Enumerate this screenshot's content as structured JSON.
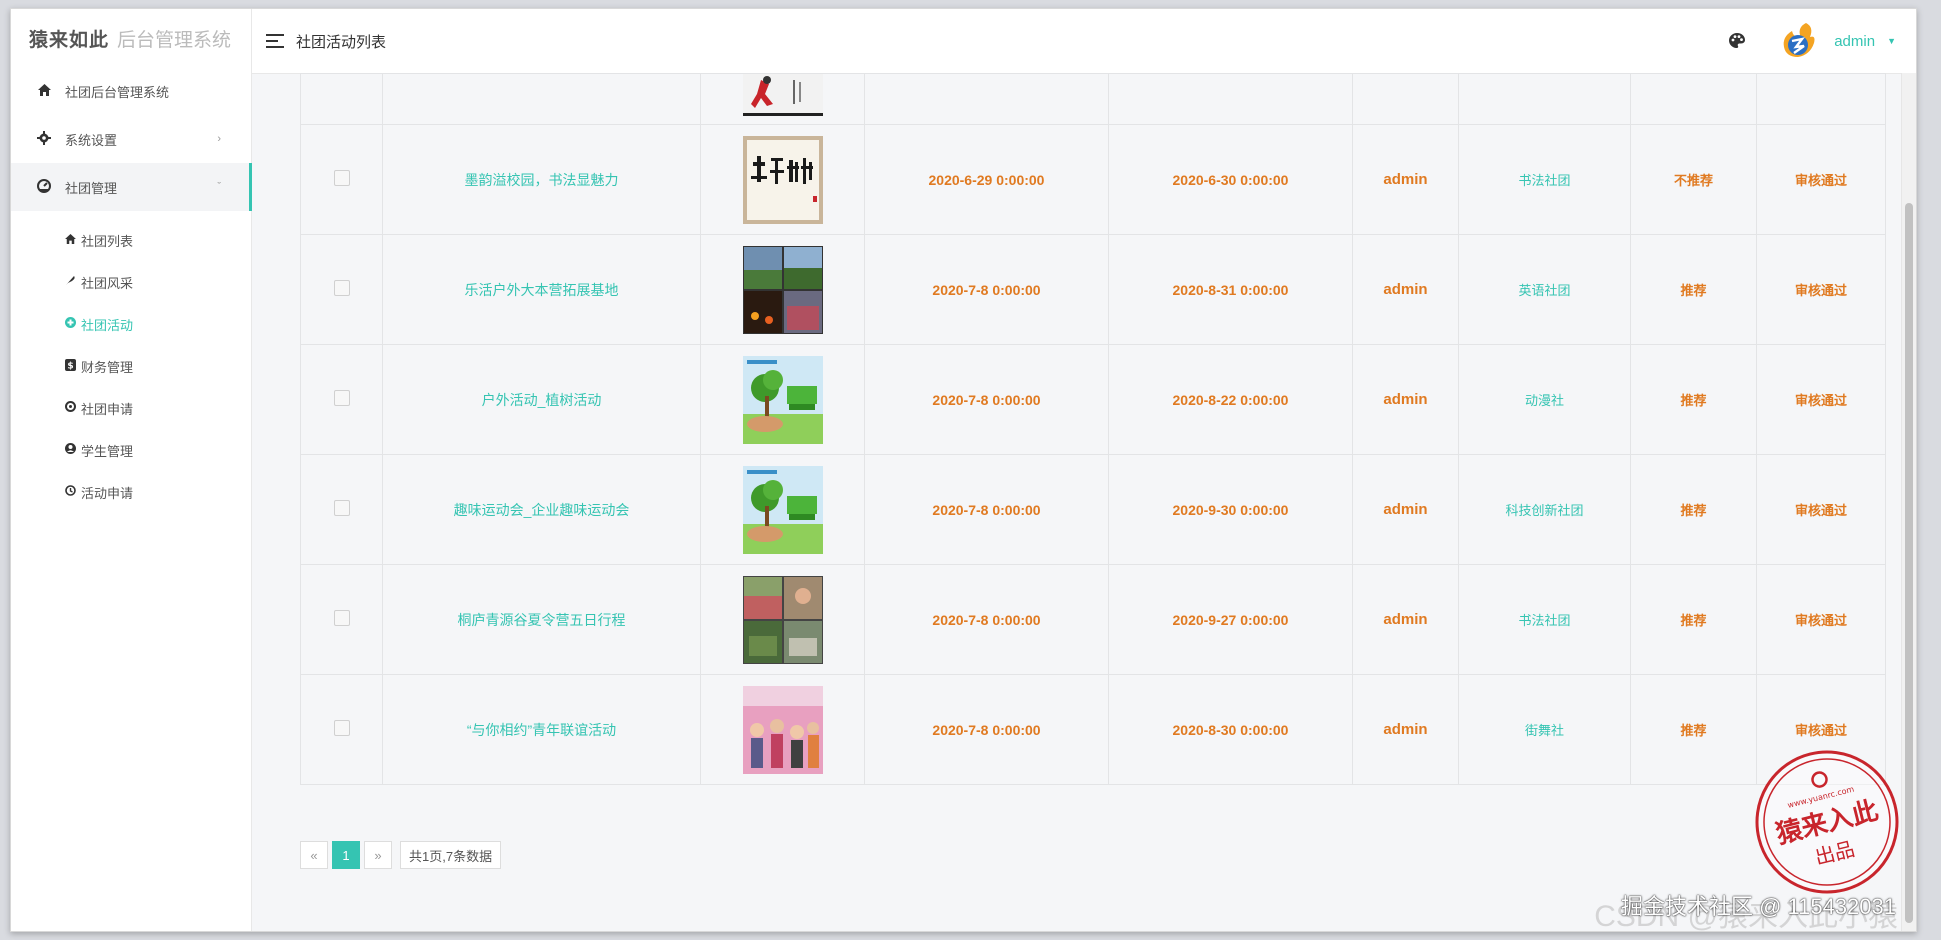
{
  "brand": {
    "logo_text": "猿来如此",
    "system_name": "后台管理系统"
  },
  "sidebar": {
    "items": [
      {
        "label": "社团后台管理系统",
        "icon": "home-icon"
      },
      {
        "label": "系统设置",
        "icon": "gear-icon",
        "arrow": "›"
      },
      {
        "label": "社团管理",
        "icon": "dashboard-icon",
        "arrow": "ˇ"
      }
    ],
    "submenu": [
      {
        "label": "社团列表",
        "icon": "home-icon"
      },
      {
        "label": "社团风采",
        "icon": "feather-icon"
      },
      {
        "label": "社团活动",
        "icon": "circle-plus-icon"
      },
      {
        "label": "财务管理",
        "icon": "dollar-icon"
      },
      {
        "label": "社团申请",
        "icon": "ring-icon"
      },
      {
        "label": "学生管理",
        "icon": "user-circle-icon"
      },
      {
        "label": "活动申请",
        "icon": "history-icon"
      }
    ]
  },
  "header": {
    "title": "社团活动列表",
    "user": "admin"
  },
  "table": {
    "rows": [
      {
        "title": "墨韵溢校园，书法显魅力",
        "image": "calligraphy",
        "start": "2020-6-29 0:00:00",
        "end": "2020-6-30 0:00:00",
        "author": "admin",
        "club": "书法社团",
        "recommend": "不推荐",
        "status": "审核通过"
      },
      {
        "title": "乐活户外大本营拓展基地",
        "image": "group-photos",
        "start": "2020-7-8 0:00:00",
        "end": "2020-8-31 0:00:00",
        "author": "admin",
        "club": "英语社团",
        "recommend": "推荐",
        "status": "审核通过"
      },
      {
        "title": "户外活动_植树活动",
        "image": "tree-planting",
        "start": "2020-7-8 0:00:00",
        "end": "2020-8-22 0:00:00",
        "author": "admin",
        "club": "动漫社",
        "recommend": "推荐",
        "status": "审核通过"
      },
      {
        "title": "趣味运动会_企业趣味运动会",
        "image": "tree-planting",
        "start": "2020-7-8 0:00:00",
        "end": "2020-9-30 0:00:00",
        "author": "admin",
        "club": "科技创新社团",
        "recommend": "推荐",
        "status": "审核通过"
      },
      {
        "title": "桐庐青源谷夏令营五日行程",
        "image": "summer-camp",
        "start": "2020-7-8 0:00:00",
        "end": "2020-9-27 0:00:00",
        "author": "admin",
        "club": "书法社团",
        "recommend": "推荐",
        "status": "审核通过"
      },
      {
        "title": "“与你相约”青年联谊活动",
        "image": "party",
        "start": "2020-7-8 0:00:00",
        "end": "2020-8-30 0:00:00",
        "author": "admin",
        "club": "街舞社",
        "recommend": "推荐",
        "status": "审核通过"
      }
    ]
  },
  "pagination": {
    "prev": "«",
    "current": "1",
    "next": "»",
    "info": "共1页,7条数据"
  },
  "stamp": {
    "main": "猿来入此",
    "sub": "出品",
    "url": "www.yuanrc.com"
  },
  "watermark": {
    "line1": "掘金技术社区 @ 115432031",
    "line2": "CSDN @猿来入此小猿"
  },
  "colors": {
    "accent": "#35c4b2",
    "value_orange": "#e07a21",
    "stamp_red": "#c8252c"
  }
}
